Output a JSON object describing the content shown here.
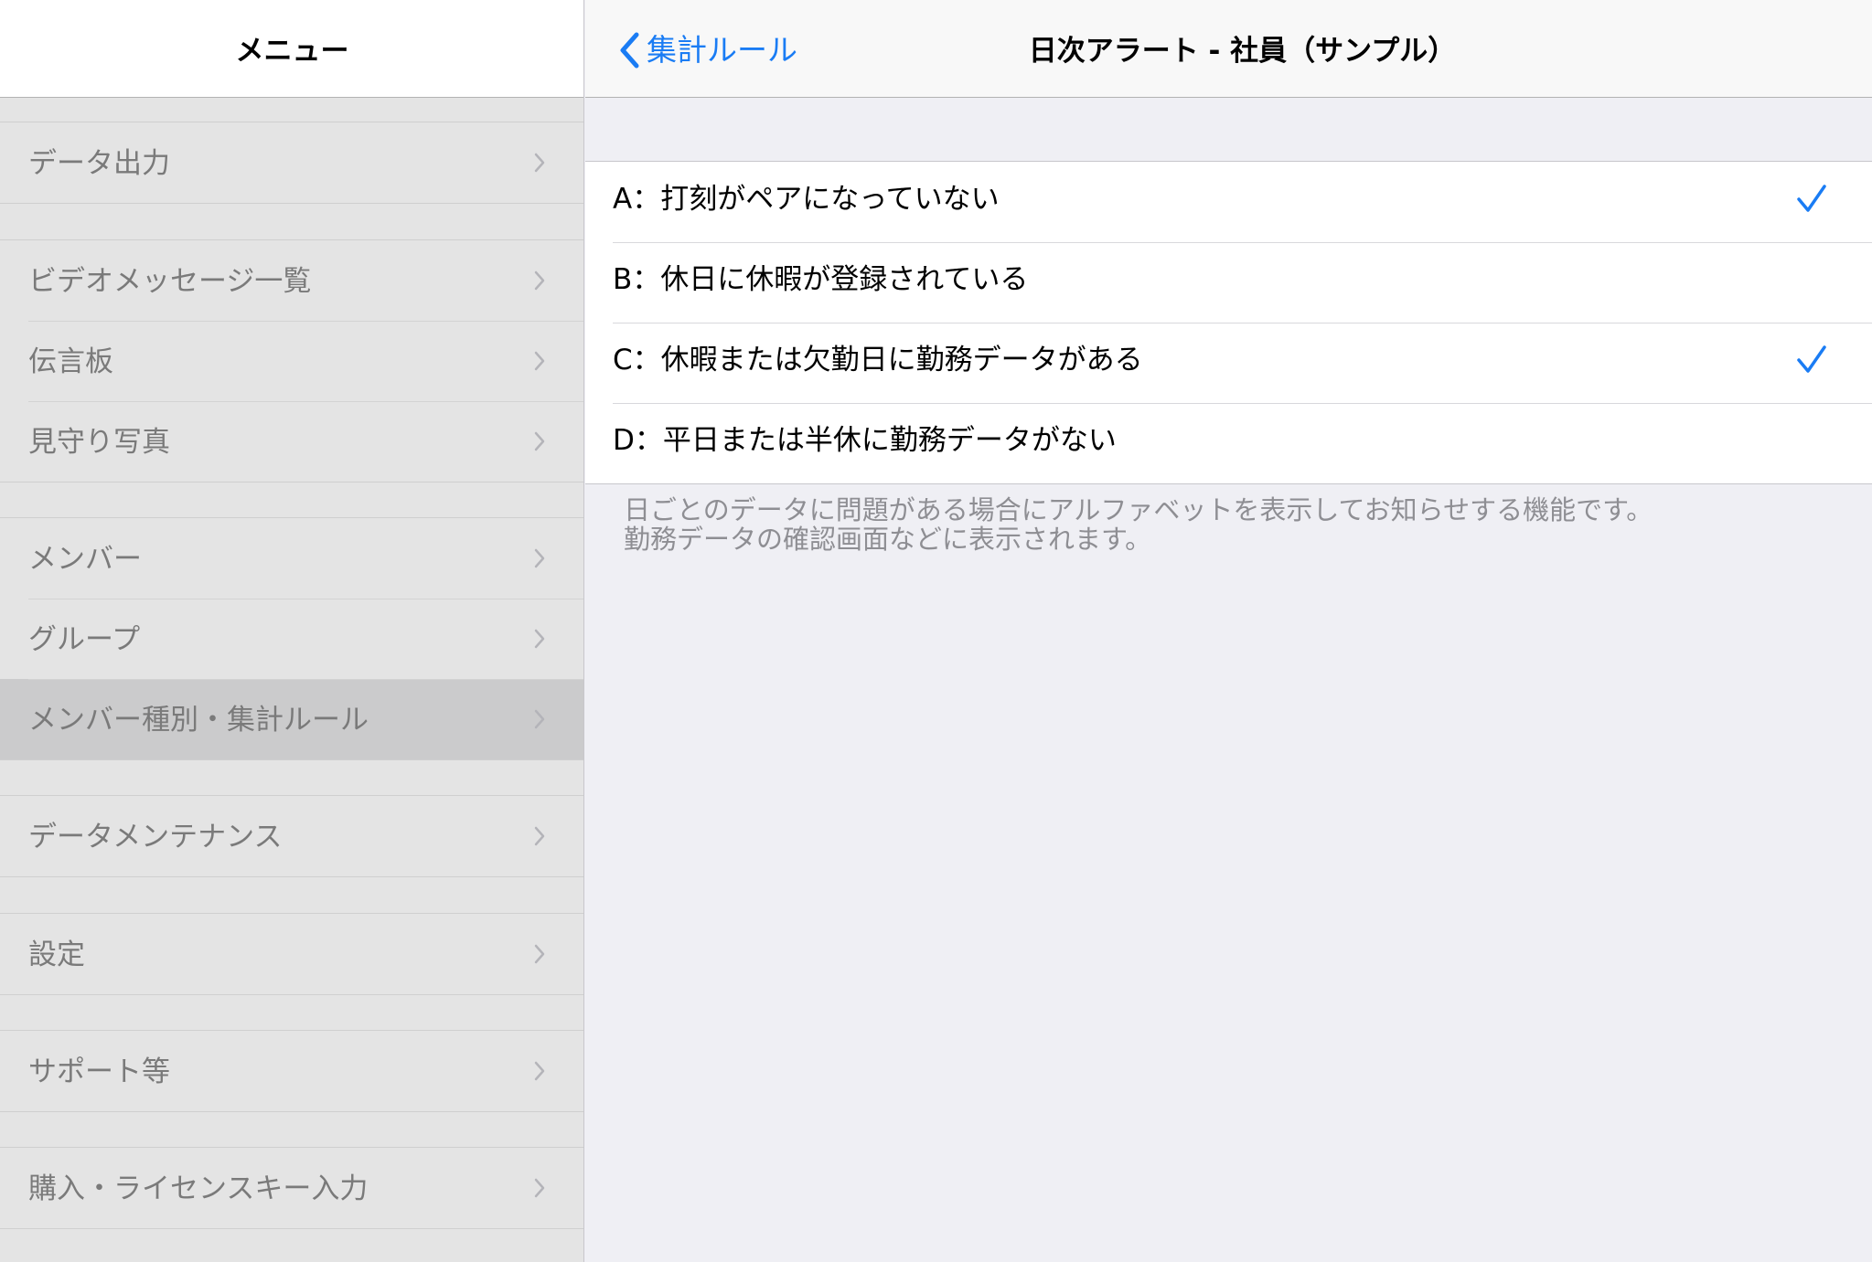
{
  "sidebar": {
    "title": "メニュー",
    "groups": [
      {
        "items": [
          {
            "label": "データ出力",
            "icon": "chevron-right-icon"
          }
        ]
      },
      {
        "items": [
          {
            "label": "ビデオメッセージ一覧",
            "icon": "chevron-right-icon"
          },
          {
            "label": "伝言板",
            "icon": "chevron-right-icon"
          },
          {
            "label": "見守り写真",
            "icon": "chevron-right-icon"
          }
        ]
      },
      {
        "items": [
          {
            "label": "メンバー",
            "icon": "chevron-right-icon"
          },
          {
            "label": "グループ",
            "icon": "chevron-right-icon"
          },
          {
            "label": "メンバー種別・集計ルール",
            "icon": "chevron-right-icon",
            "selected": true
          }
        ]
      },
      {
        "items": [
          {
            "label": "データメンテナンス",
            "icon": "chevron-right-icon"
          }
        ]
      },
      {
        "items": [
          {
            "label": "設定",
            "icon": "chevron-right-icon"
          }
        ]
      },
      {
        "items": [
          {
            "label": "サポート等",
            "icon": "chevron-right-icon"
          }
        ]
      },
      {
        "items": [
          {
            "label": "購入・ライセンスキー入力",
            "icon": "chevron-right-icon"
          }
        ]
      }
    ]
  },
  "main": {
    "back_label": "集計ルール",
    "back_icon": "chevron-left-icon",
    "title": "日次アラート - 社員（サンプル）",
    "alerts": [
      {
        "label": "A：打刻がペアになっていない",
        "checked": true
      },
      {
        "label": "B：休日に休暇が登録されている",
        "checked": false
      },
      {
        "label": "C：休暇または欠勤日に勤務データがある",
        "checked": true
      },
      {
        "label": "D：平日または半休に勤務データがない",
        "checked": false
      }
    ],
    "footer_lines": [
      "日ごとのデータに問題がある場合にアルファベットを表示してお知らせする機能です。",
      "勤務データの確認画面などに表示されます。"
    ]
  },
  "colors": {
    "accent": "#1a7cf4",
    "sidebar_bg": "#e4e4e4",
    "selected_bg": "#cbcbcc",
    "content_bg": "#efeff4"
  }
}
